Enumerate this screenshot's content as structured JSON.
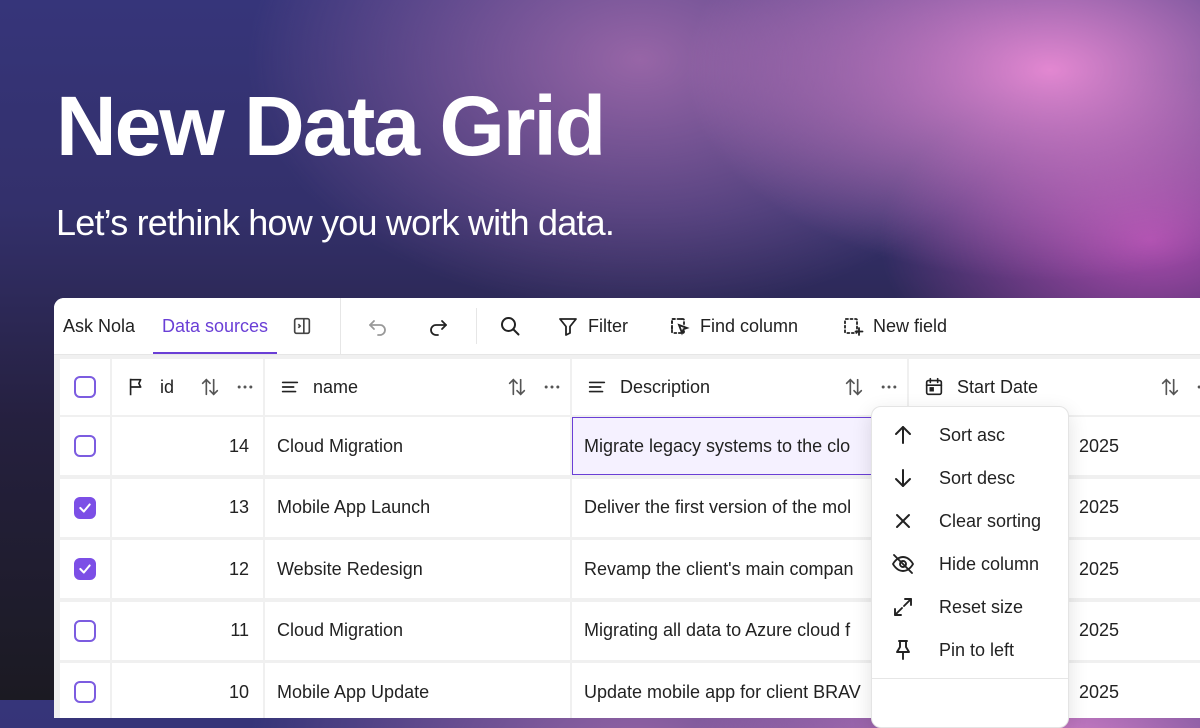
{
  "hero": {
    "title": "New Data Grid",
    "subtitle": "Let’s rethink how you work with data."
  },
  "toolbar": {
    "tab_ask": "Ask Nola",
    "tab_data_sources": "Data sources",
    "filter_label": "Filter",
    "find_column_label": "Find column",
    "new_field_label": "New field",
    "icons": [
      "sidebar-toggle-icon",
      "undo-icon",
      "redo-icon",
      "search-icon",
      "filter-icon",
      "find-column-icon",
      "new-field-icon"
    ]
  },
  "columns": [
    {
      "label": "id",
      "icon": "flag-icon"
    },
    {
      "label": "name",
      "icon": "text-icon"
    },
    {
      "label": "Description",
      "icon": "text-icon"
    },
    {
      "label": "Start Date",
      "icon": "calendar-icon"
    }
  ],
  "rows": [
    {
      "checked": false,
      "id": "14",
      "name": "Cloud Migration",
      "description": "Migrate legacy systems to the clo",
      "start_date": "2025"
    },
    {
      "checked": true,
      "id": "13",
      "name": "Mobile App Launch",
      "description": "Deliver the first version of the mol",
      "start_date": "2025"
    },
    {
      "checked": true,
      "id": "12",
      "name": "Website Redesign",
      "description": "Revamp the client's main compan",
      "start_date": "2025"
    },
    {
      "checked": false,
      "id": "11",
      "name": "Cloud Migration",
      "description": "Migrating all data to Azure cloud f",
      "start_date": "2025"
    },
    {
      "checked": false,
      "id": "10",
      "name": "Mobile App Update",
      "description": "Update mobile app for client BRAV",
      "start_date": "2025"
    }
  ],
  "column_menu": {
    "items": [
      {
        "label": "Sort asc",
        "icon": "arrow-up-icon"
      },
      {
        "label": "Sort desc",
        "icon": "arrow-down-icon"
      },
      {
        "label": "Clear sorting",
        "icon": "close-icon"
      },
      {
        "label": "Hide column",
        "icon": "eye-off-icon"
      },
      {
        "label": "Reset size",
        "icon": "expand-icon"
      },
      {
        "label": "Pin to left",
        "icon": "pin-icon"
      }
    ]
  },
  "colors": {
    "accent": "#6a3fd6",
    "checkbox_checked": "#7c4fe6",
    "grid_bg": "#f0f0f0"
  }
}
